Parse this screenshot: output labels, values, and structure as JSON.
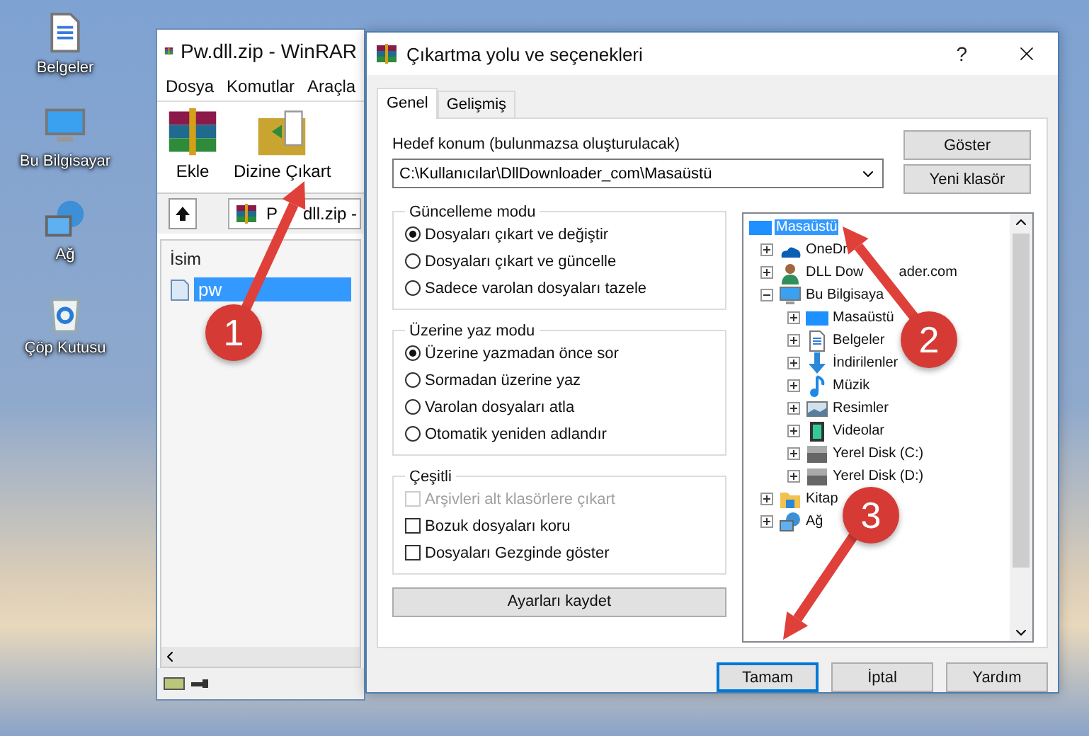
{
  "desktop_icons": [
    {
      "label": "Belgeler",
      "kind": "documents"
    },
    {
      "label": "Bu Bilgisayar",
      "kind": "computer"
    },
    {
      "label": "Ağ",
      "kind": "network"
    },
    {
      "label": "Çöp Kutusu",
      "kind": "recycle"
    }
  ],
  "winrar": {
    "title": "Pw.dll.zip - WinRAR",
    "menu": [
      "Dosya",
      "Komutlar",
      "Araçla"
    ],
    "toolbar": [
      {
        "label": "Ekle",
        "kind": "add"
      },
      {
        "label": "Dizine Çıkart",
        "kind": "extract"
      }
    ],
    "address_parts": [
      "P",
      "dll.zip -"
    ],
    "columns": [
      "İsim"
    ],
    "files": [
      {
        "name": "pw",
        "selected": true
      }
    ]
  },
  "dialog": {
    "title": "Çıkartma yolu ve seçenekleri",
    "help": "?",
    "tabs": [
      {
        "label": "Genel",
        "selected": true
      },
      {
        "label": "Gelişmiş",
        "selected": false
      }
    ],
    "destination_label": "Hedef konum (bulunmazsa oluşturulacak)",
    "destination": "C:\\Kullanıcılar\\DllDownloader_com\\Masaüstü",
    "side_buttons": [
      "Göster",
      "Yeni klasör"
    ],
    "groups": [
      {
        "title": "Güncelleme modu",
        "options": [
          {
            "kind": "radio",
            "label": "Dosyaları çıkart ve değiştir",
            "selected": true
          },
          {
            "kind": "radio",
            "label": "Dosyaları çıkart ve güncelle",
            "selected": false
          },
          {
            "kind": "radio",
            "label": "Sadece varolan dosyaları tazele",
            "selected": false
          }
        ]
      },
      {
        "title": "Üzerine yaz modu",
        "options": [
          {
            "kind": "radio",
            "label": "Üzerine yazmadan önce sor",
            "selected": true
          },
          {
            "kind": "radio",
            "label": "Sormadan üzerine yaz",
            "selected": false
          },
          {
            "kind": "radio",
            "label": "Varolan dosyaları atla",
            "selected": false
          },
          {
            "kind": "radio",
            "label": "Otomatik yeniden adlandır",
            "selected": false
          }
        ]
      },
      {
        "title": "Çeşitli",
        "options": [
          {
            "kind": "checkbox",
            "label": "Arşivleri alt klasörlere çıkart",
            "checked": false,
            "disabled": true
          },
          {
            "kind": "checkbox",
            "label": "Bozuk dosyaları koru",
            "checked": false,
            "disabled": false
          },
          {
            "kind": "checkbox",
            "label": "Dosyaları Gezginde göster",
            "checked": false,
            "disabled": false
          }
        ]
      }
    ],
    "save_button": "Ayarları kaydet",
    "tree": [
      {
        "label": "Masaüstü",
        "kind": "desktop",
        "selected": true,
        "children": [
          {
            "label": "OneDr",
            "kind": "cloud",
            "selected": false,
            "expanded": false
          },
          {
            "label": "DLL Dow",
            "label_after": "ader.com",
            "kind": "user",
            "selected": false,
            "expanded": false
          },
          {
            "label": "Bu Bilgisaya",
            "kind": "computer",
            "selected": false,
            "expanded": true,
            "children": [
              {
                "label": "Masaüstü",
                "kind": "desktop",
                "selected": false,
                "expanded": false
              },
              {
                "label": "Belgeler",
                "kind": "documents",
                "selected": false,
                "expanded": false
              },
              {
                "label": "İndirilenler",
                "kind": "download",
                "selected": false,
                "expanded": false
              },
              {
                "label": "Müzik",
                "kind": "music",
                "selected": false,
                "expanded": false
              },
              {
                "label": "Resimler",
                "kind": "pictures",
                "selected": false,
                "expanded": false
              },
              {
                "label": "Videolar",
                "kind": "videos",
                "selected": false,
                "expanded": false
              },
              {
                "label": "Yerel Disk (C:)",
                "kind": "disk",
                "selected": false,
                "expanded": false
              },
              {
                "label": "Yerel Disk (D:)",
                "kind": "disk",
                "selected": false,
                "expanded": false
              }
            ]
          },
          {
            "label": "Kitap",
            "kind": "library",
            "selected": false,
            "expanded": false
          },
          {
            "label": "Ağ",
            "kind": "network",
            "selected": false,
            "expanded": false
          }
        ]
      }
    ],
    "buttons": [
      {
        "label": "Tamam",
        "default": true
      },
      {
        "label": "İptal",
        "default": false
      },
      {
        "label": "Yardım",
        "default": false
      }
    ]
  },
  "annotations": [
    {
      "number": "1"
    },
    {
      "number": "2"
    },
    {
      "number": "3"
    }
  ]
}
